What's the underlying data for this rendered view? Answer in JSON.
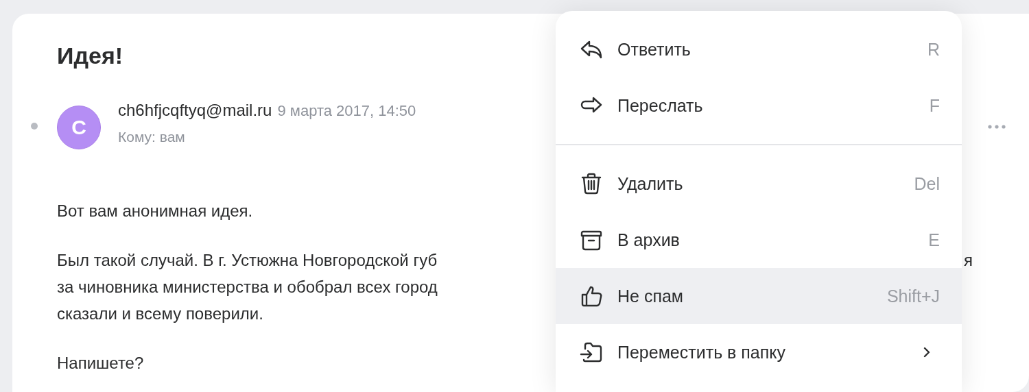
{
  "message": {
    "subject": "Идея!",
    "unread": true,
    "sender": {
      "initial": "C",
      "email": "ch6hfjcqftyq@mail.ru",
      "date": "9 марта 2017, 14:50",
      "recipient": "Кому: вам"
    },
    "body": [
      {
        "lines": [
          {
            "text": "Вот вам анонимная идея."
          }
        ]
      },
      {
        "lines": [
          {
            "text": "Был такой случай. В г. Устюжна Новгородской губ",
            "text_after_menu": "я"
          },
          {
            "text": "за чиновника министерства и обобрал всех город"
          },
          {
            "text": "сказали и всему поверили."
          }
        ]
      },
      {
        "lines": [
          {
            "text": "Напишете?"
          }
        ]
      }
    ]
  },
  "context_menu": {
    "groups": [
      [
        {
          "label": "Ответить",
          "shortcut": "R",
          "selected": false,
          "kind": "action"
        },
        {
          "label": "Переслать",
          "shortcut": "F",
          "selected": false,
          "kind": "action"
        }
      ],
      [
        {
          "label": "Удалить",
          "shortcut": "Del",
          "selected": false,
          "kind": "action"
        },
        {
          "label": "В архив",
          "shortcut": "E",
          "selected": false,
          "kind": "action"
        },
        {
          "label": "Не спам",
          "shortcut": "Shift+J",
          "selected": true,
          "kind": "action"
        },
        {
          "label": "Переместить в папку",
          "selected": false,
          "kind": "submenu"
        }
      ]
    ]
  }
}
